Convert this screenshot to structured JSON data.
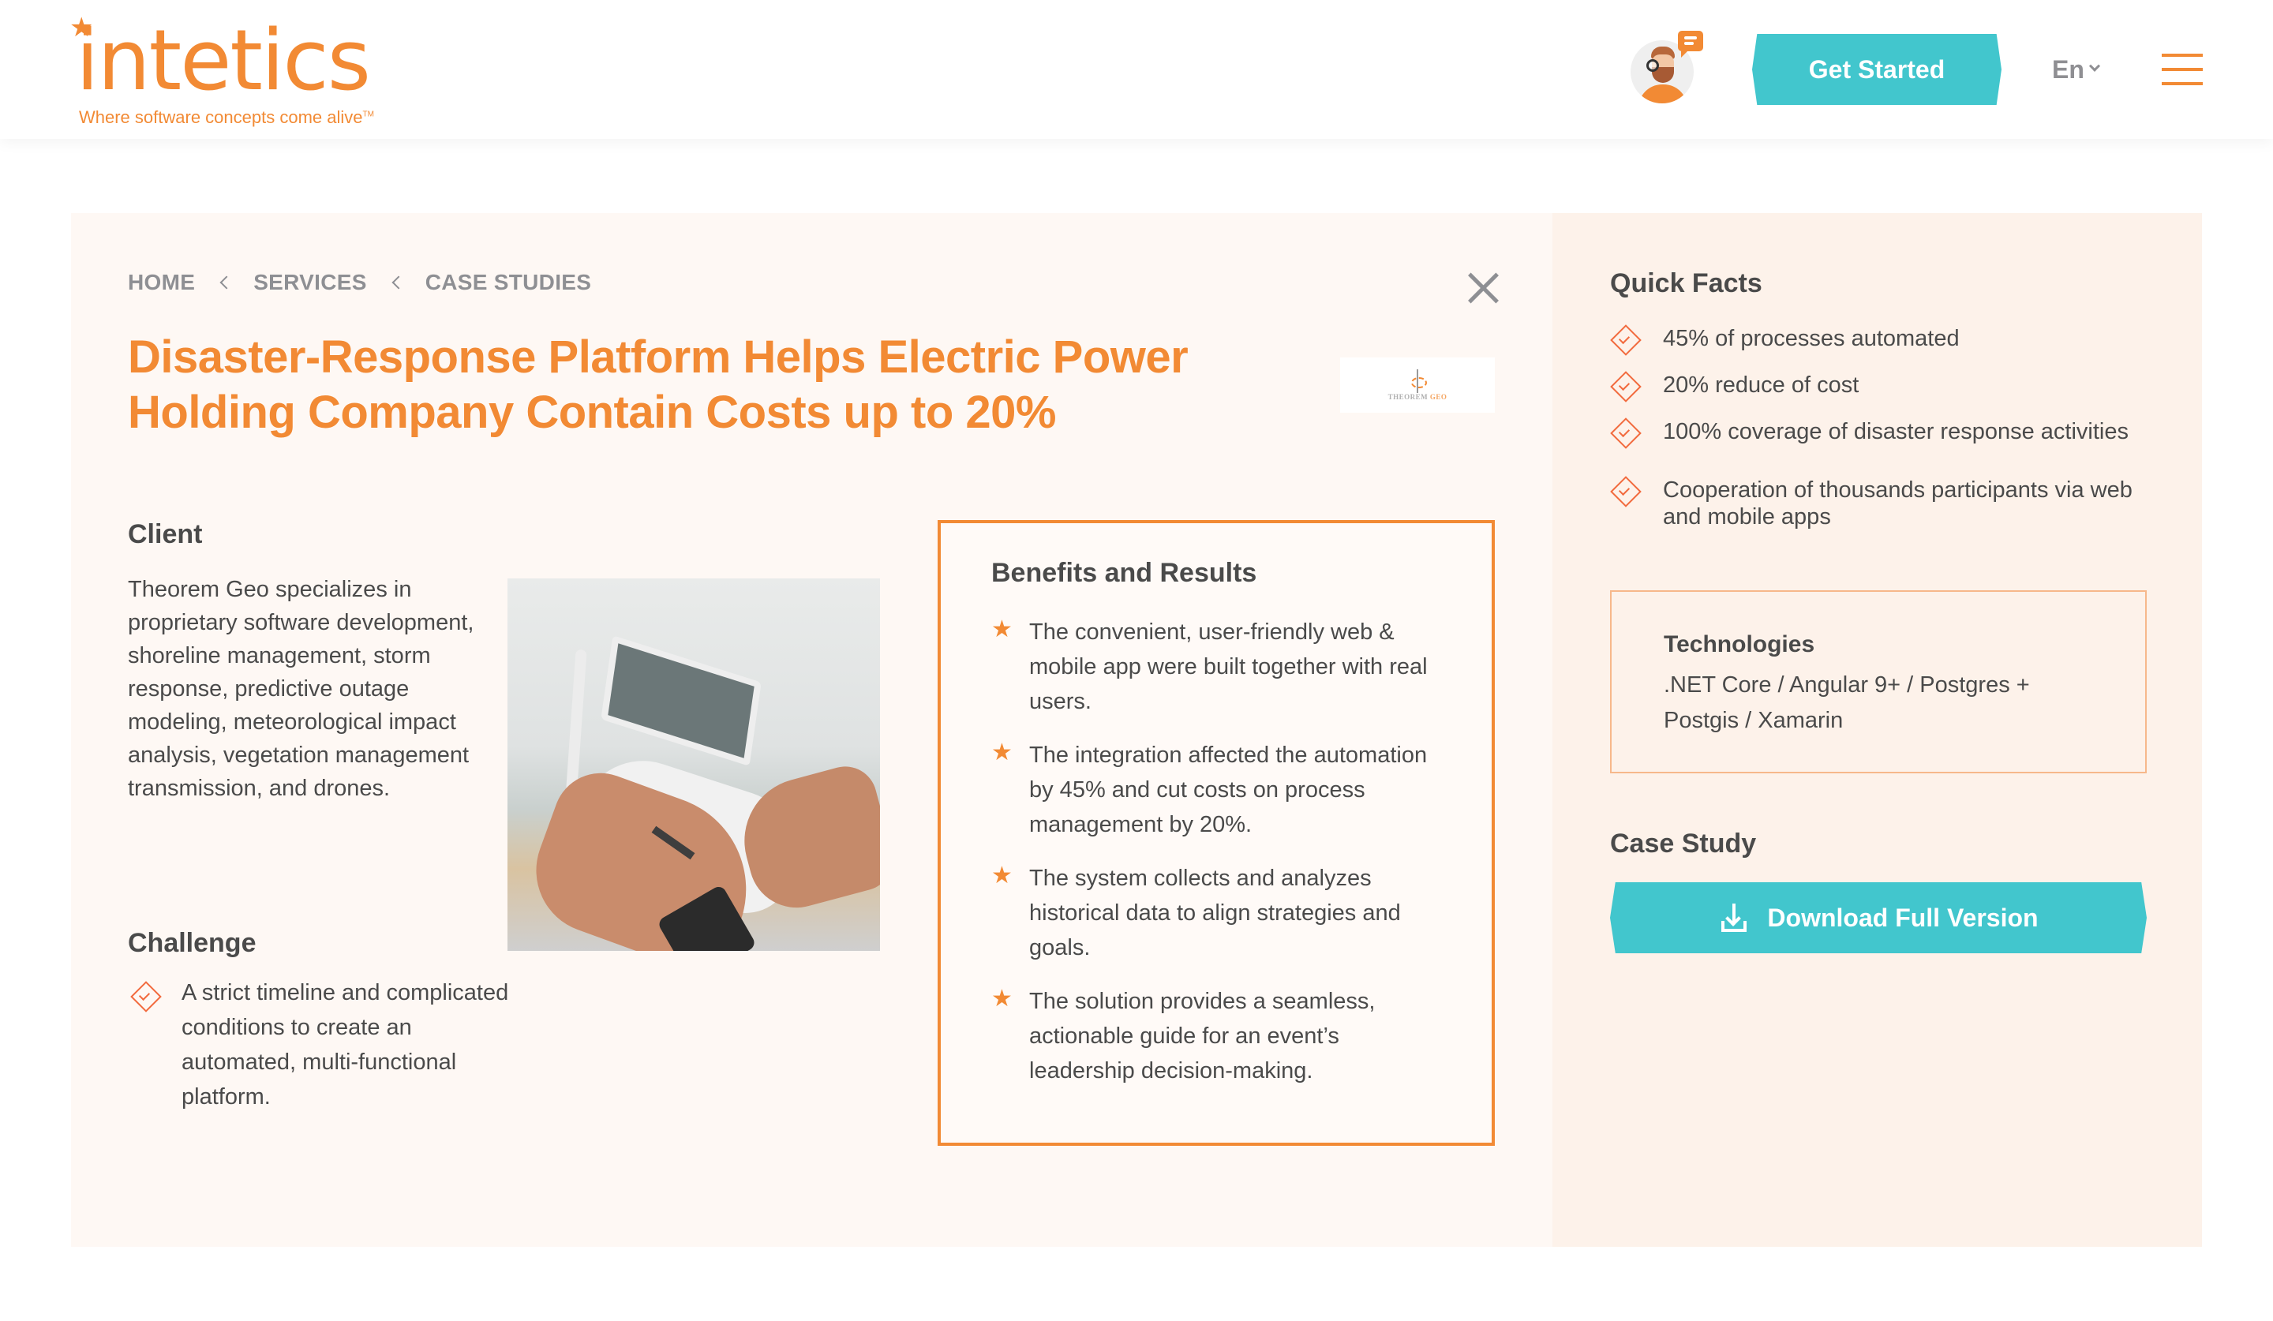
{
  "header": {
    "logo_text": "intetics",
    "logo_tagline": "Where software concepts come alive",
    "logo_tm": "TM",
    "get_started_label": "Get Started",
    "language": "En",
    "colors": {
      "brand": "#f28a34",
      "accent": "#42c6cd"
    }
  },
  "breadcrumb": [
    {
      "label": "HOME"
    },
    {
      "label": "SERVICES"
    },
    {
      "label": "CASE STUDIES"
    }
  ],
  "main": {
    "title": "Disaster-Response Platform Helps Electric Power Holding Company Contain Costs up to 20%",
    "client_logo": {
      "name_a": "THEOREM",
      "name_b": "GEO"
    },
    "client": {
      "heading": "Client",
      "text": "Theorem Geo specializes in proprietary software development, shoreline management, storm response, predictive outage modeling, meteorological impact analysis, vegetation management transmission, and drones."
    },
    "challenge": {
      "heading": "Challenge",
      "items": [
        "A strict timeline and complicated conditions to create an automated, multi-functional platform."
      ]
    },
    "benefits": {
      "heading": "Benefits and Results",
      "items": [
        "The convenient, user-friendly web & mobile app were built together with real users.",
        "The integration affected the automation by 45% and cut costs on process management by 20%.",
        "The system collects and analyzes historical data to align strategies and goals.",
        "The solution provides a seamless, actionable guide for an event’s leadership decision-making."
      ]
    }
  },
  "side": {
    "quick_facts": {
      "heading": "Quick Facts",
      "items": [
        "45% of processes automated",
        "20% reduce of cost",
        "100% coverage of disaster response activities",
        "Cooperation of thousands participants via web and mobile apps"
      ]
    },
    "technologies": {
      "heading": "Technologies",
      "text": ".NET Core / Angular 9+ / Postgres + Postgis / Xamarin"
    },
    "case_study": {
      "heading": "Case Study",
      "download_label": "Download Full Version"
    }
  }
}
